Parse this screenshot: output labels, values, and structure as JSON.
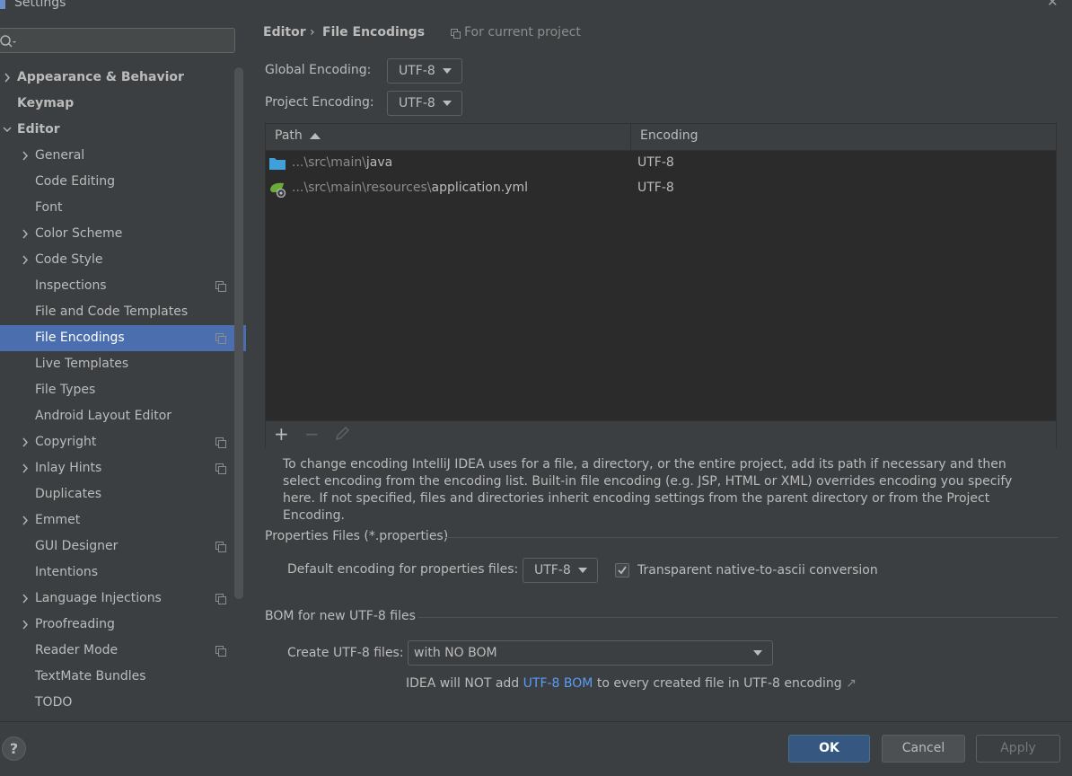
{
  "window": {
    "title": "Settings"
  },
  "search": {
    "placeholder": ""
  },
  "sidebar": {
    "items": [
      {
        "label": "Appearance & Behavior",
        "level": 0,
        "bold": true,
        "expandable": true,
        "expanded": false,
        "project_scope": false
      },
      {
        "label": "Keymap",
        "level": 0,
        "bold": true,
        "expandable": false,
        "project_scope": false
      },
      {
        "label": "Editor",
        "level": 0,
        "bold": true,
        "expandable": true,
        "expanded": true,
        "project_scope": false
      },
      {
        "label": "General",
        "level": 1,
        "expandable": true,
        "project_scope": false
      },
      {
        "label": "Code Editing",
        "level": 1,
        "expandable": false,
        "project_scope": false
      },
      {
        "label": "Font",
        "level": 1,
        "expandable": false,
        "project_scope": false
      },
      {
        "label": "Color Scheme",
        "level": 1,
        "expandable": true,
        "project_scope": false
      },
      {
        "label": "Code Style",
        "level": 1,
        "expandable": true,
        "project_scope": false
      },
      {
        "label": "Inspections",
        "level": 1,
        "expandable": false,
        "project_scope": true
      },
      {
        "label": "File and Code Templates",
        "level": 1,
        "expandable": false,
        "project_scope": false
      },
      {
        "label": "File Encodings",
        "level": 1,
        "expandable": false,
        "project_scope": true,
        "selected": true
      },
      {
        "label": "Live Templates",
        "level": 1,
        "expandable": false,
        "project_scope": false
      },
      {
        "label": "File Types",
        "level": 1,
        "expandable": false,
        "project_scope": false
      },
      {
        "label": "Android Layout Editor",
        "level": 1,
        "expandable": false,
        "project_scope": false
      },
      {
        "label": "Copyright",
        "level": 1,
        "expandable": true,
        "project_scope": true
      },
      {
        "label": "Inlay Hints",
        "level": 1,
        "expandable": true,
        "project_scope": true
      },
      {
        "label": "Duplicates",
        "level": 1,
        "expandable": false,
        "project_scope": false
      },
      {
        "label": "Emmet",
        "level": 1,
        "expandable": true,
        "project_scope": false
      },
      {
        "label": "GUI Designer",
        "level": 1,
        "expandable": false,
        "project_scope": true
      },
      {
        "label": "Intentions",
        "level": 1,
        "expandable": false,
        "project_scope": false
      },
      {
        "label": "Language Injections",
        "level": 1,
        "expandable": true,
        "project_scope": true
      },
      {
        "label": "Proofreading",
        "level": 1,
        "expandable": true,
        "project_scope": false
      },
      {
        "label": "Reader Mode",
        "level": 1,
        "expandable": false,
        "project_scope": true
      },
      {
        "label": "TextMate Bundles",
        "level": 1,
        "expandable": false,
        "project_scope": false
      },
      {
        "label": "TODO",
        "level": 1,
        "expandable": false,
        "project_scope": false
      }
    ]
  },
  "breadcrumb": {
    "parent": "Editor",
    "separator": "›",
    "current": "File Encodings",
    "scope": "For current project"
  },
  "encoding": {
    "global_label": "Global Encoding:",
    "global_value": "UTF-8",
    "project_label": "Project Encoding:",
    "project_value": "UTF-8"
  },
  "table": {
    "col_path": "Path",
    "col_encoding": "Encoding",
    "rows": [
      {
        "prefix": "...\\src\\main\\",
        "name": "java",
        "icon": "folder-icon",
        "encoding": "UTF-8"
      },
      {
        "prefix": "...\\src\\main\\resources\\",
        "name": "application.yml",
        "icon": "spring-config-icon",
        "encoding": "UTF-8"
      }
    ],
    "toolbar": {
      "add": "+",
      "remove": "−"
    }
  },
  "info": {
    "text": "To change encoding IntelliJ IDEA uses for a file, a directory, or the entire project, add its path if necessary and then select encoding from the encoding list. Built-in file encoding (e.g. JSP, HTML or XML) overrides encoding you specify here. If not specified, files and directories inherit encoding settings from the parent directory or from the Project Encoding."
  },
  "properties": {
    "section_title": "Properties Files (*.properties)",
    "default_label": "Default encoding for properties files:",
    "default_value": "UTF-8",
    "transparent_label": "Transparent native-to-ascii conversion",
    "transparent_checked": true
  },
  "bom": {
    "section_title": "BOM for new UTF-8 files",
    "create_label": "Create UTF-8 files:",
    "create_value": "with NO BOM",
    "note_before": "IDEA will NOT add ",
    "note_link": "UTF-8 BOM",
    "note_after": " to every created file in UTF-8 encoding",
    "note_arrow": "↗"
  },
  "footer": {
    "help": "?",
    "ok": "OK",
    "cancel": "Cancel",
    "apply": "Apply"
  },
  "colors": {
    "background": "#3c3f41",
    "selection": "#4b6eaf",
    "link": "#589df6",
    "ok_button": "#365880"
  }
}
